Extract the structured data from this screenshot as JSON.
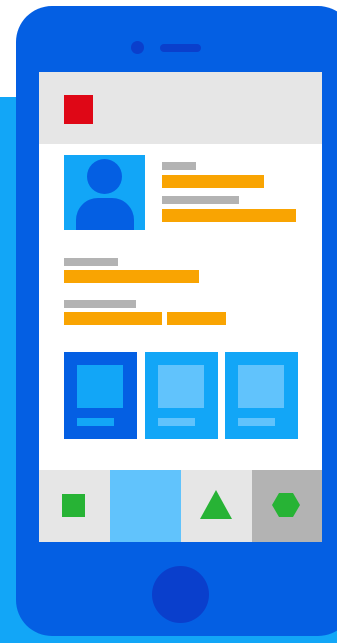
{
  "illustration": {
    "subject": "phone-profile-screen",
    "colors": {
      "background_panel": "#12a6f7",
      "phone_body": "#045fe3",
      "phone_details": "#0a3fcc",
      "screen": "#ffffff",
      "app_bar": "#e6e6e6",
      "logo": "#df0716",
      "label_placeholder": "#b3b3b3",
      "value_placeholder": "#f9a402",
      "card_active": "#045fe3",
      "card_normal": "#12a6f7",
      "card_highlight": "#61c3fc",
      "tab_icon": "#27b335",
      "tab_default": "#e6e6e6",
      "tab_selected": "#61c3fc",
      "tab_last": "#b3b3b3"
    },
    "profile": {
      "avatar_icon": "user-icon"
    },
    "cards": [
      {
        "state": "active"
      },
      {
        "state": "normal"
      },
      {
        "state": "normal"
      }
    ],
    "tabs": [
      {
        "icon": "square-icon",
        "selected": false
      },
      {
        "icon": "none",
        "selected": true
      },
      {
        "icon": "triangle-icon",
        "selected": false
      },
      {
        "icon": "hexagon-icon",
        "selected": false
      }
    ]
  }
}
